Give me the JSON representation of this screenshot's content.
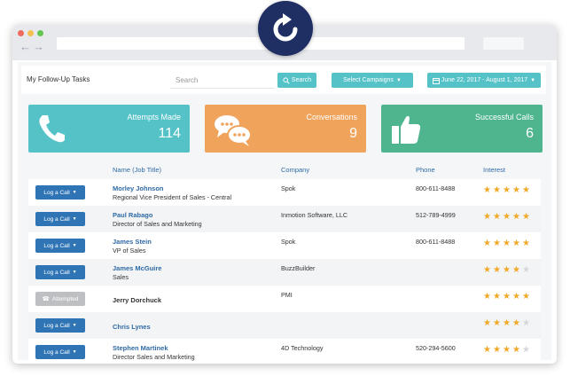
{
  "colors": {
    "teal": "#54c2c7",
    "orange": "#f0a35b",
    "green": "#4fb58f",
    "blue": "#2f75b6",
    "star_on": "#f1a925",
    "star_off": "#d3d6da",
    "reload_bg": "#1f2f63"
  },
  "toolbar": {
    "title": "My Follow-Up Tasks",
    "search_placeholder": "Search",
    "search_button": "Search",
    "campaigns_button": "Select Campaigns",
    "date_range": "June 22, 2017 - August 1, 2017"
  },
  "stats": [
    {
      "label": "Attempts Made",
      "value": "114",
      "icon": "phone-icon"
    },
    {
      "label": "Conversations",
      "value": "9",
      "icon": "chat-bubbles-icon"
    },
    {
      "label": "Successful Calls",
      "value": "6",
      "icon": "thumbs-up-icon"
    }
  ],
  "table": {
    "headers": {
      "name": "Name (Job Title)",
      "company": "Company",
      "phone": "Phone",
      "interest": "Interest"
    },
    "rows": [
      {
        "action": "Log a Call",
        "state": "log",
        "name": "Morley Johnson",
        "job": "Regional Vice President of Sales - Central",
        "company": "Spok",
        "phone": "800-611-8488",
        "stars": 5
      },
      {
        "action": "Log a Call",
        "state": "log",
        "name": "Paul Rabago",
        "job": "Director of Sales and Marketing",
        "company": "Inmotion Software, LLC",
        "phone": "512-789-4999",
        "stars": 5
      },
      {
        "action": "Log a Call",
        "state": "log",
        "name": "James Stein",
        "job": "VP of Sales",
        "company": "Spok",
        "phone": "800-611-8488",
        "stars": 5
      },
      {
        "action": "Log a Call",
        "state": "log",
        "name": "James McGuire",
        "job": "Sales",
        "company": "BuzzBuilder",
        "phone": "",
        "stars": 4
      },
      {
        "action": "Attempted",
        "state": "attempted",
        "name": "Jerry Dorchuck",
        "job": "",
        "company": "PMI",
        "phone": "",
        "stars": 5
      },
      {
        "action": "Log a Call",
        "state": "log",
        "name": "Chris Lynes",
        "job": "",
        "company": "",
        "phone": "",
        "stars": 4
      },
      {
        "action": "Log a Call",
        "state": "log",
        "name": "Stephen Martinek",
        "job": "Director Sales and Marketing",
        "company": "4D Technology",
        "phone": "520-294-5600",
        "stars": 4
      }
    ]
  }
}
